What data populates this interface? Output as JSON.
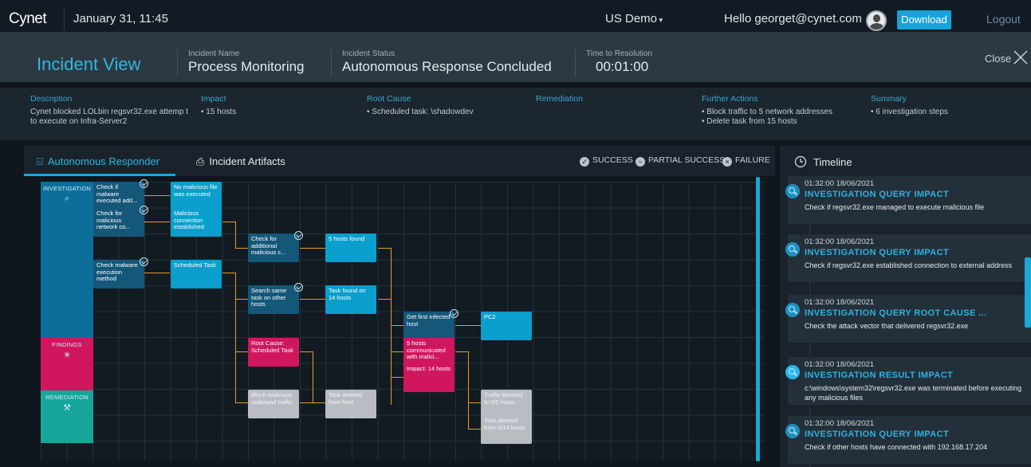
{
  "topbar": {
    "logo": "Cynet",
    "datetime": "January 31, 11:45",
    "tenant": "US Demo",
    "hello": "Hello georget@cynet.com",
    "download": "Download",
    "logout": "Logout"
  },
  "incident": {
    "title": "Incident View",
    "name_label": "Incident Name",
    "name_value": "Process Monitoring",
    "status_label": "Incident Status",
    "status_value": "Autonomous Response Concluded",
    "ttr_label": "Time to Resolution",
    "ttr_value": "00:01:00",
    "close_label": "Close"
  },
  "details": {
    "description_label": "Description",
    "description_text": "Cynet blocked LOLbin regsvr32.exe attemp t to execute on Infra-Server2",
    "impact_label": "Impact",
    "impact_text": "• 15 hosts",
    "root_cause_label": "Root Cause",
    "root_cause_text": "• Scheduled task: \\shadowdev",
    "remediation_label": "Remediation",
    "further_label": "Further Actions",
    "further_1": "• Block traffic to 5 network addresses",
    "further_2": "• Delete task from 15 hosts",
    "summary_label": "Summary",
    "summary_text": "• 6 investigation steps"
  },
  "tabs": {
    "responder": "Autonomous Responder",
    "artifacts": "Incident Artifacts"
  },
  "legend": {
    "success": "SUCCESS",
    "partial": "PARTIAL SUCCESS",
    "failure": "FAILURE"
  },
  "lanes": {
    "investigation": "INVESTIGATION",
    "findings": "FINDINGS",
    "remediation": "REMEDIATION"
  },
  "nodes": {
    "n1": "Check if malware executed add...",
    "n2": "No malicious file was executed",
    "n3": "Check for malicious network co...",
    "n4": "Malicious connection established",
    "n5": "Check for additional malicious c...",
    "n6": "5 hosts found",
    "n7": "Check malware execution method",
    "n8": "Scheduled Task",
    "n9": "Search same task on other hosts",
    "n10": "Task found on 14 hosts",
    "n11": "Get first infected host",
    "n12": "PC2",
    "n13": "Root Cause: Scheduled Task",
    "n14": "5 hosts communicated with malici...",
    "n15": "Impact: 14 hosts",
    "n16": "Block malicious outbound traffic",
    "n17": "Task deleted from host",
    "n18": "Traffic blocked to 0/5 hosts",
    "n19": "Task deleted from 0/14 hosts"
  },
  "timeline": {
    "title": "Timeline",
    "items": [
      {
        "time": "01:32:00 18/06/2021",
        "head": "INVESTIGATION QUERY IMPACT",
        "desc": "Check if regsvr32.exe managed to execute malicious file"
      },
      {
        "time": "01:32:00 18/06/2021",
        "head": "INVESTIGATION QUERY IMPACT",
        "desc": "Check if regsvr32.exe established connection to external address"
      },
      {
        "time": "01:32:00 18/06/2021",
        "head": "INVESTIGATION QUERY ROOT CAUSE ...",
        "desc": "Check the attack vector that delivered regsvr32.exe"
      },
      {
        "time": "01:32:00 18/06/2021",
        "head": "INVESTIGATION RESULT IMPACT",
        "desc": "c:\\windows\\system32\\regsvr32.exe was terminated before executing any malicious files"
      },
      {
        "time": "01:32:00 18/06/2021",
        "head": "INVESTIGATION QUERY IMPACT",
        "desc": "Check if other hosts have connected with 192.168.17.204"
      }
    ]
  },
  "colors": {
    "accent": "#1ca6d9",
    "investigation_lane": "#0b6f9a",
    "findings_lane": "#d0175e",
    "remediation_lane": "#16a79a",
    "connector": "#e59b24"
  }
}
